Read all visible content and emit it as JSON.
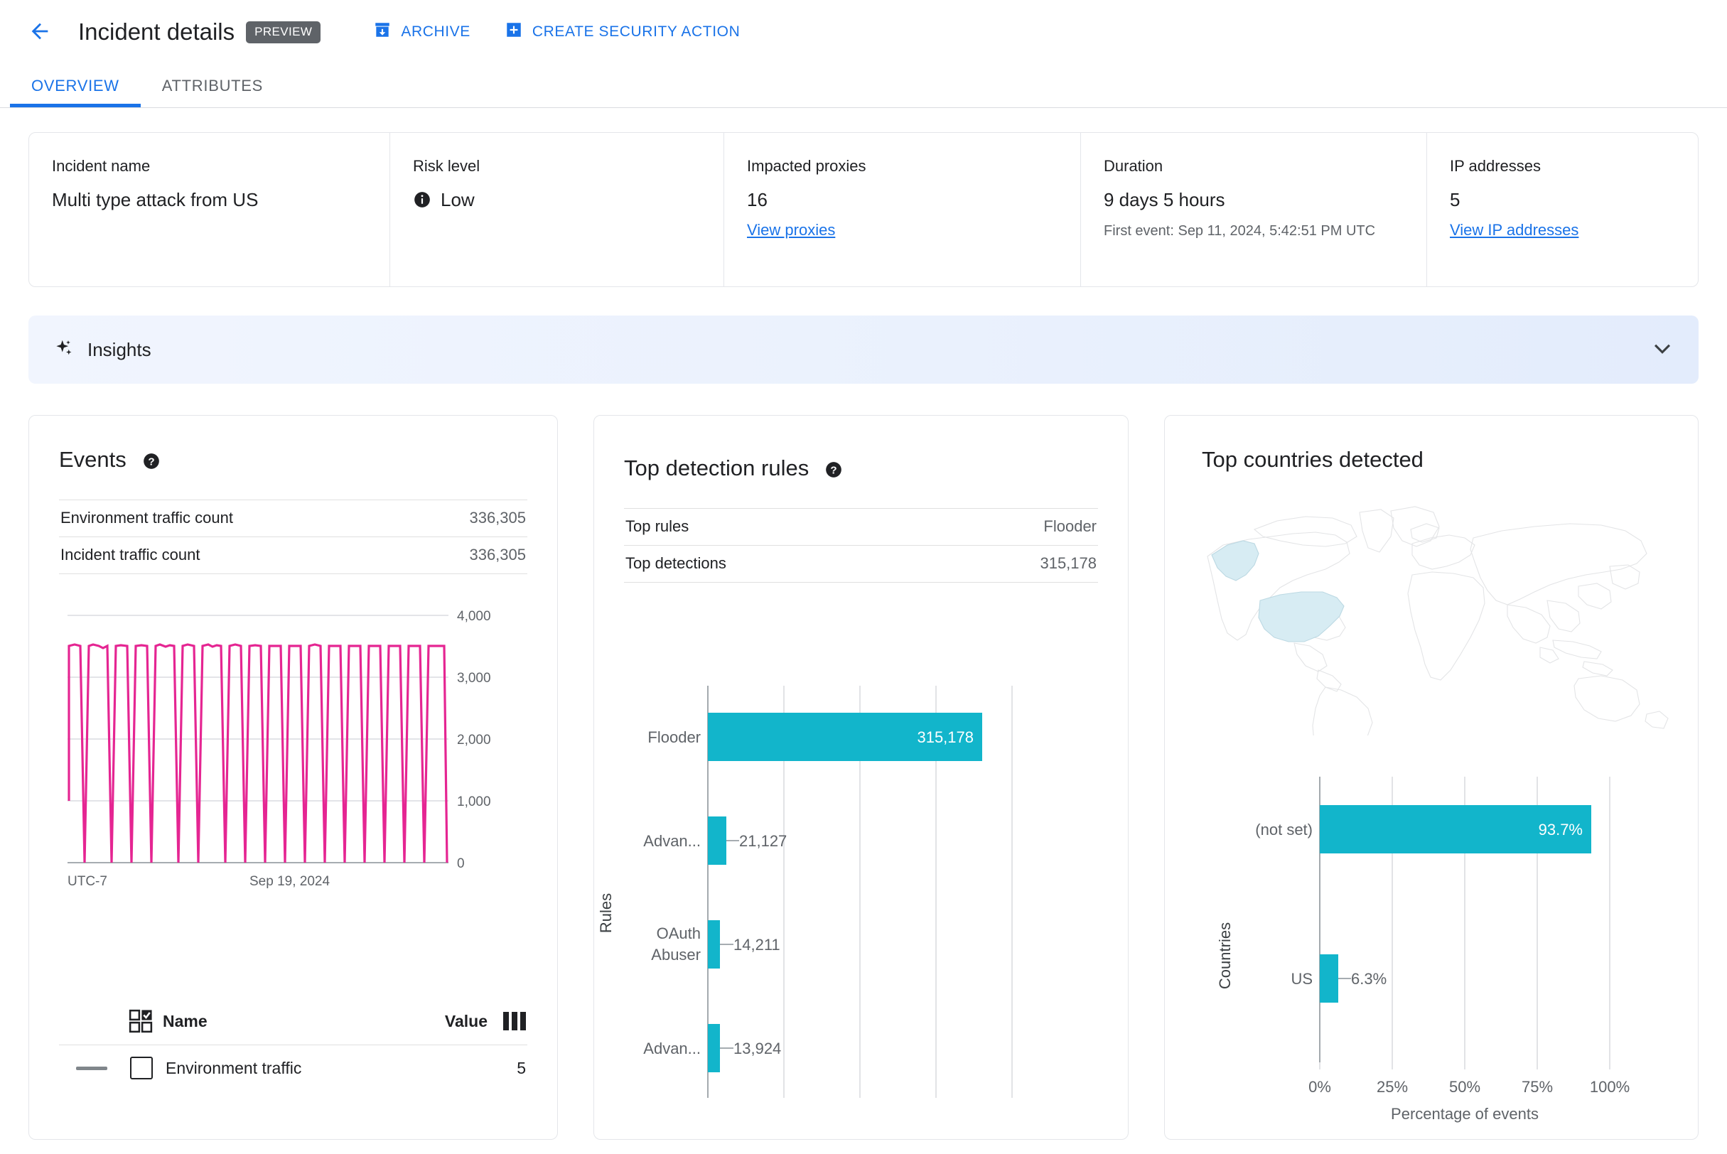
{
  "header": {
    "back_icon": "arrow-left-icon",
    "title": "Incident details",
    "preview_badge": "PREVIEW",
    "actions": [
      {
        "label": "ARCHIVE",
        "icon": "archive-icon"
      },
      {
        "label": "CREATE SECURITY ACTION",
        "icon": "add-box-icon"
      }
    ]
  },
  "tabs": [
    {
      "label": "OVERVIEW",
      "active": true
    },
    {
      "label": "ATTRIBUTES",
      "active": false
    }
  ],
  "summary": {
    "incident_name": {
      "label": "Incident name",
      "value": "Multi type attack from US"
    },
    "risk_level": {
      "label": "Risk level",
      "value": "Low",
      "icon": "info-icon"
    },
    "impacted_proxies": {
      "label": "Impacted proxies",
      "value": "16",
      "link": "View proxies"
    },
    "duration": {
      "label": "Duration",
      "value": "9 days 5 hours",
      "sub": "First event: Sep 11, 2024, 5:42:51 PM UTC"
    },
    "ip_addresses": {
      "label": "IP addresses",
      "value": "5",
      "link": "View IP addresses"
    }
  },
  "insights": {
    "title": "Insights",
    "icon": "sparkle-icon",
    "chevron": "chevron-down-icon"
  },
  "events_card": {
    "title": "Events",
    "help_icon": "help-icon",
    "rows": [
      {
        "key": "Environment traffic count",
        "value": "336,305"
      },
      {
        "key": "Incident traffic count",
        "value": "336,305"
      }
    ],
    "legend": {
      "select_icon": "select-all-icon",
      "name_header": "Name",
      "value_header": "Value",
      "columns_icon": "columns-icon",
      "items": [
        {
          "label": "Environment traffic",
          "value": "5"
        }
      ]
    }
  },
  "rules_card": {
    "title": "Top detection rules",
    "help_icon": "help-icon",
    "rows": [
      {
        "key": "Top rules",
        "value": "Flooder"
      },
      {
        "key": "Top detections",
        "value": "315,178"
      }
    ]
  },
  "countries_card": {
    "title": "Top countries detected",
    "map_icon": "world-map",
    "highlighted_regions": [
      "US",
      "Alaska"
    ]
  },
  "colors": {
    "accent_blue": "#1a73e8",
    "bar_teal": "#12b5cb",
    "line_pink": "#e52592",
    "preview_chip": "#5f6368",
    "map_highlight": "#d7ecf3"
  },
  "chart_data": [
    {
      "type": "line",
      "title": "Events",
      "xlabel": "UTC-7",
      "ylabel": "",
      "ylim": [
        0,
        4000
      ],
      "yticks": [
        0,
        1000,
        2000,
        3000,
        4000
      ],
      "ytick_labels": [
        "0",
        "1,000",
        "2,000",
        "3,000",
        "4,000"
      ],
      "xtick_labels": [
        "UTC-7",
        "Sep 19, 2024"
      ],
      "grid": true,
      "legend_position": "bottom",
      "series": [
        {
          "name": "Environment traffic",
          "color": "#e52592",
          "shape": "sawtooth",
          "cycles": 10,
          "peak": 3500,
          "trough": 0,
          "values": [
            1050,
            3500,
            3500,
            0,
            3500,
            3500,
            0,
            3500,
            3500,
            0,
            3500,
            3500,
            0,
            3500,
            3500,
            0,
            3500,
            3500,
            0,
            3500,
            3500,
            0,
            3500,
            3500,
            0,
            3500,
            3500,
            0,
            3500,
            3500
          ]
        }
      ]
    },
    {
      "type": "bar",
      "orientation": "horizontal",
      "title": "Top detection rules",
      "ylabel": "Rules",
      "xlabel": "",
      "categories": [
        "Flooder",
        "Advan...",
        "OAuth Abuser",
        "Advan..."
      ],
      "values": [
        315178,
        21127,
        14211,
        13924
      ],
      "value_labels": [
        "315,178",
        "21,127",
        "14,211",
        "13,924"
      ],
      "xlim": [
        0,
        350000
      ],
      "color": "#12b5cb",
      "grid": true
    },
    {
      "type": "bar",
      "orientation": "horizontal",
      "title": "Top countries detected",
      "ylabel": "Countries",
      "xlabel": "Percentage of events",
      "categories": [
        "(not set)",
        "US"
      ],
      "values": [
        93.7,
        6.3
      ],
      "value_labels": [
        "93.7%",
        "6.3%"
      ],
      "xlim": [
        0,
        100
      ],
      "xticks": [
        0,
        25,
        50,
        75,
        100
      ],
      "xtick_labels": [
        "0%",
        "25%",
        "50%",
        "75%",
        "100%"
      ],
      "color": "#12b5cb",
      "grid": true
    }
  ]
}
